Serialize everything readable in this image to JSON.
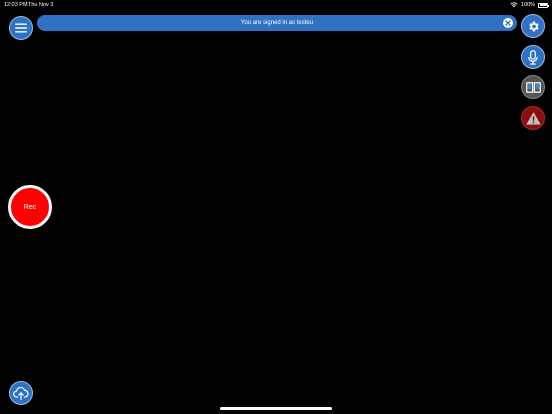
{
  "status_bar": {
    "time": "12:03 PM",
    "date": "Thu Nov 3",
    "battery": "100%"
  },
  "banner": {
    "message": "You are signed in as testeu"
  },
  "record": {
    "label": "Rec"
  },
  "icons": {
    "menu": "hamburger-icon",
    "close": "close-icon",
    "settings": "gear-icon",
    "mic": "microphone-icon",
    "split": "split-view-icon",
    "warning": "warning-icon",
    "upload": "cloud-upload-icon"
  },
  "colors": {
    "accent_blue": "#2f72c3",
    "record_red": "#ff0000",
    "warning_red": "#8b0d0d",
    "neutral_gray": "#555555",
    "background": "#000000"
  }
}
